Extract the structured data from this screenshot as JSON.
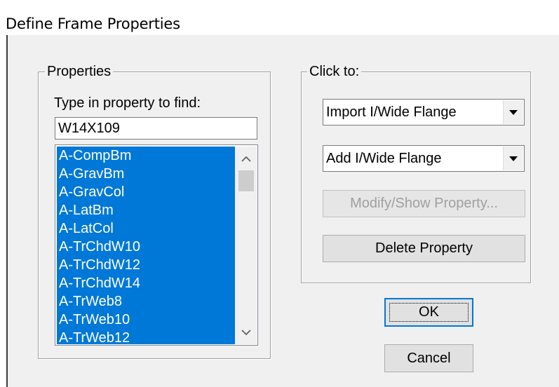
{
  "window": {
    "title": "Define Frame Properties"
  },
  "properties_group": {
    "legend": "Properties",
    "search_label": "Type in property to find:",
    "search_value": "W14X109",
    "list_items": [
      "A-CompBm",
      "A-GravBm",
      "A-GravCol",
      "A-LatBm",
      "A-LatCol",
      "A-TrChdW10",
      "A-TrChdW12",
      "A-TrChdW14",
      "A-TrWeb8",
      "A-TrWeb10",
      "A-TrWeb12"
    ]
  },
  "click_to_group": {
    "legend": "Click to:",
    "import_selected": "Import I/Wide Flange",
    "add_selected": "Add I/Wide Flange",
    "modify_label": "Modify/Show Property...",
    "delete_label": "Delete Property"
  },
  "actions": {
    "ok_label": "OK",
    "cancel_label": "Cancel"
  },
  "colors": {
    "selection": "#0078d7",
    "dialog_bg": "#f0f0f0"
  },
  "icons": {
    "scroll_up": "chevron-up-icon",
    "scroll_down": "chevron-down-icon",
    "dropdown": "triangle-down-icon"
  }
}
